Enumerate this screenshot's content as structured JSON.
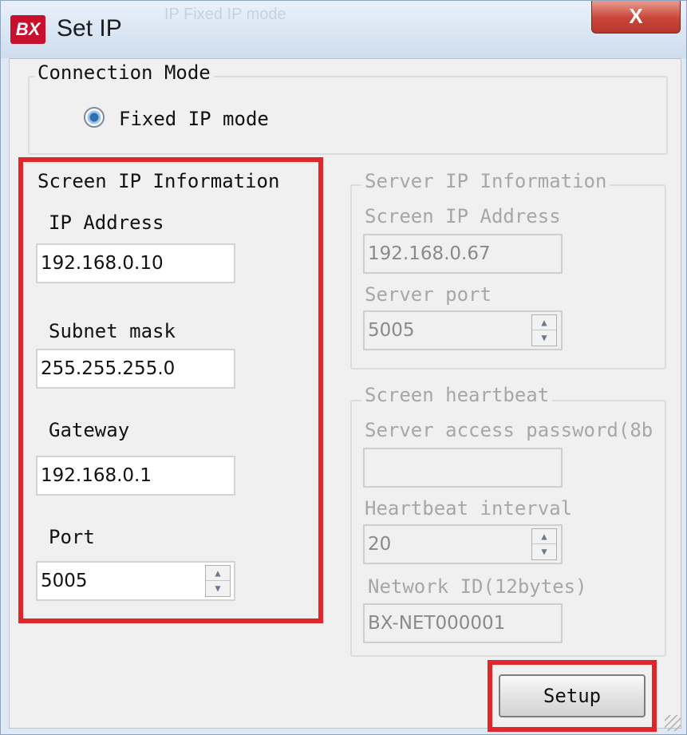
{
  "window": {
    "title": "Set IP",
    "app_icon": "BX",
    "ghost_title": "IP Fixed IP mode",
    "close_glyph": "X"
  },
  "connection": {
    "legend": "Connection Mode",
    "mode_label": "Fixed IP mode"
  },
  "screen_ip": {
    "legend": "Screen IP Information",
    "ip_label": "IP Address",
    "ip_value": "192.168.0.10",
    "subnet_label": "Subnet mask",
    "subnet_value": "255.255.255.0",
    "gateway_label": "Gateway",
    "gateway_value": "192.168.0.1",
    "port_label": "Port",
    "port_value": "5005"
  },
  "server_ip": {
    "legend": "Server IP Information",
    "screen_ip_label": "Screen IP Address",
    "screen_ip_value": "192.168.0.67",
    "port_label": "Server port",
    "port_value": "5005"
  },
  "heartbeat": {
    "legend": "Screen heartbeat",
    "password_label": "Server access password(8b",
    "password_value": "",
    "interval_label": "Heartbeat interval",
    "interval_value": "20",
    "network_id_label": "Network ID(12bytes)",
    "network_id_value": "BX-NET000001"
  },
  "buttons": {
    "setup": "Setup"
  },
  "colors": {
    "highlight": "#e0252b",
    "disabled_text": "#a7a7a7"
  }
}
